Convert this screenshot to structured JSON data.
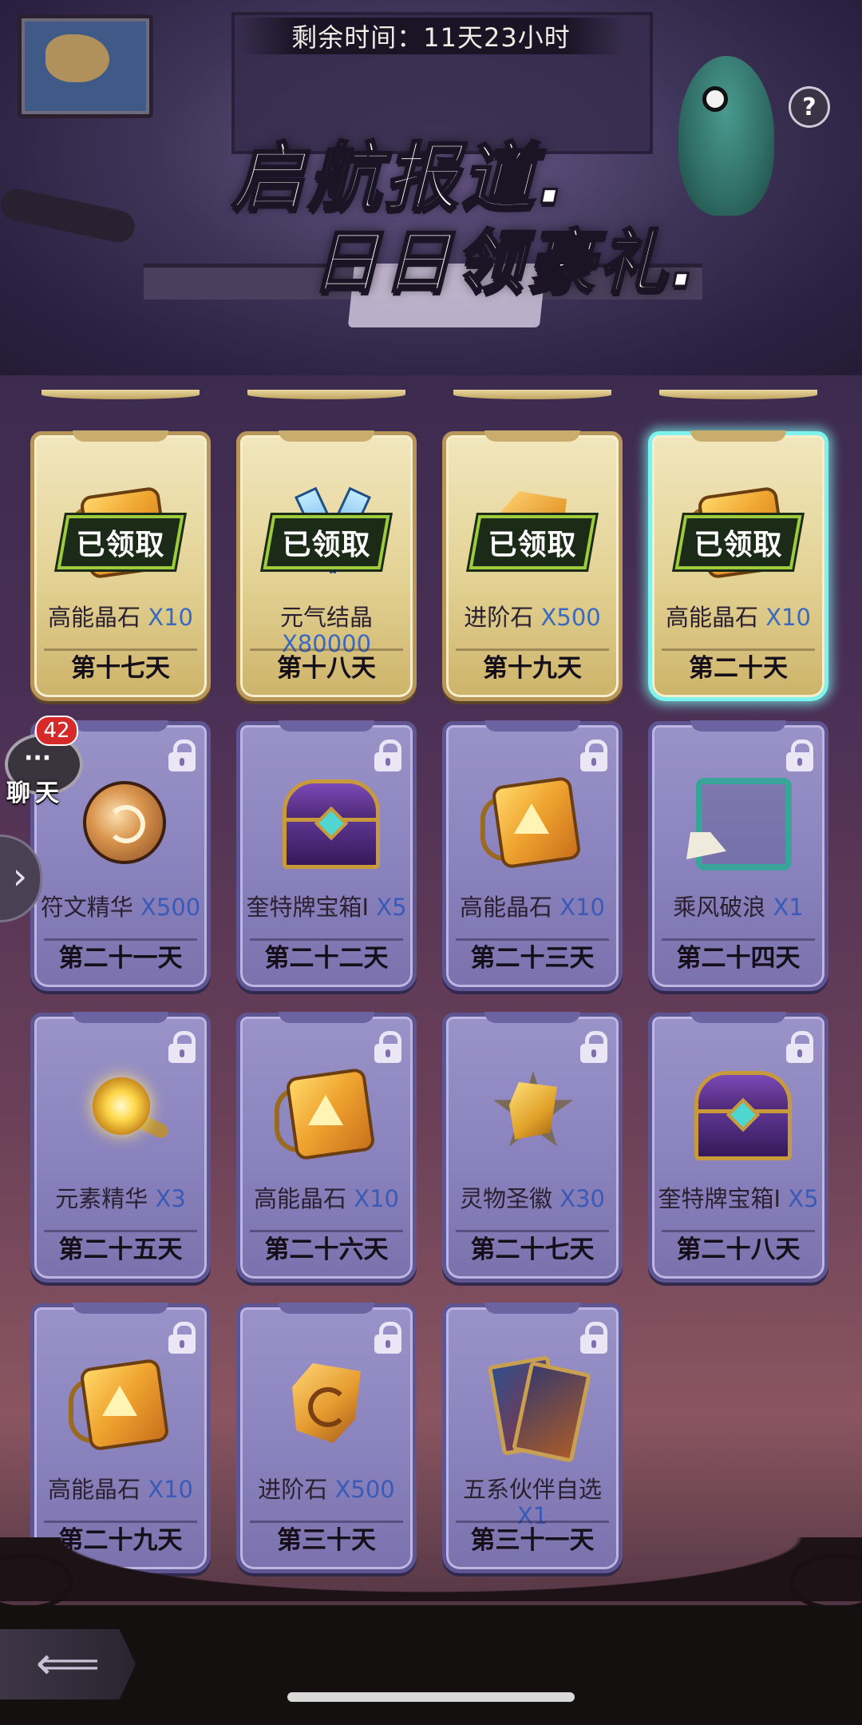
{
  "header": {
    "timer": "剩余时间：11天23小时",
    "title_line1": "启航报道.",
    "title_line2": "日日领豪礼.",
    "help_label": "?"
  },
  "claimed_label": "已领取",
  "cards": [
    {
      "name": "高能晶石",
      "qty": "X10",
      "day": "第十七天",
      "state": "claimed",
      "icon": "energy-crystal-icon"
    },
    {
      "name": "元气结晶",
      "qty": "X80000",
      "day": "第十八天",
      "state": "claimed",
      "icon": "vitality-crystal-icon"
    },
    {
      "name": "进阶石",
      "qty": "X500",
      "day": "第十九天",
      "state": "claimed",
      "icon": "advance-stone-icon"
    },
    {
      "name": "高能晶石",
      "qty": "X10",
      "day": "第二十天",
      "state": "claimed-current",
      "icon": "energy-crystal-icon"
    },
    {
      "name": "符文精华",
      "qty": "X500",
      "day": "第二十一天",
      "state": "locked",
      "icon": "rune-essence-icon"
    },
    {
      "name": "奎特牌宝箱I",
      "qty": "X5",
      "day": "第二十二天",
      "state": "locked",
      "icon": "treasure-chest-icon"
    },
    {
      "name": "高能晶石",
      "qty": "X10",
      "day": "第二十三天",
      "state": "locked",
      "icon": "energy-crystal-icon"
    },
    {
      "name": "乘风破浪",
      "qty": "X1",
      "day": "第二十四天",
      "state": "locked",
      "icon": "avatar-frame-icon"
    },
    {
      "name": "元素精华",
      "qty": "X3",
      "day": "第二十五天",
      "state": "locked",
      "icon": "element-essence-icon"
    },
    {
      "name": "高能晶石",
      "qty": "X10",
      "day": "第二十六天",
      "state": "locked",
      "icon": "energy-crystal-icon"
    },
    {
      "name": "灵物圣徽",
      "qty": "X30",
      "day": "第二十七天",
      "state": "locked",
      "icon": "spirit-emblem-icon"
    },
    {
      "name": "奎特牌宝箱I",
      "qty": "X5",
      "day": "第二十八天",
      "state": "locked",
      "icon": "treasure-chest-icon"
    },
    {
      "name": "高能晶石",
      "qty": "X10",
      "day": "第二十九天",
      "state": "locked",
      "icon": "energy-crystal-icon"
    },
    {
      "name": "进阶石",
      "qty": "X500",
      "day": "第三十天",
      "state": "locked",
      "icon": "advance-stone-icon"
    },
    {
      "name": "五系伙伴自选",
      "qty": "X1",
      "day": "第三十一天",
      "state": "locked",
      "icon": "partner-cards-icon"
    }
  ],
  "chat": {
    "badge": "42",
    "label": "聊天"
  },
  "side_tab_glyph": "›",
  "back_glyph": "⟸"
}
